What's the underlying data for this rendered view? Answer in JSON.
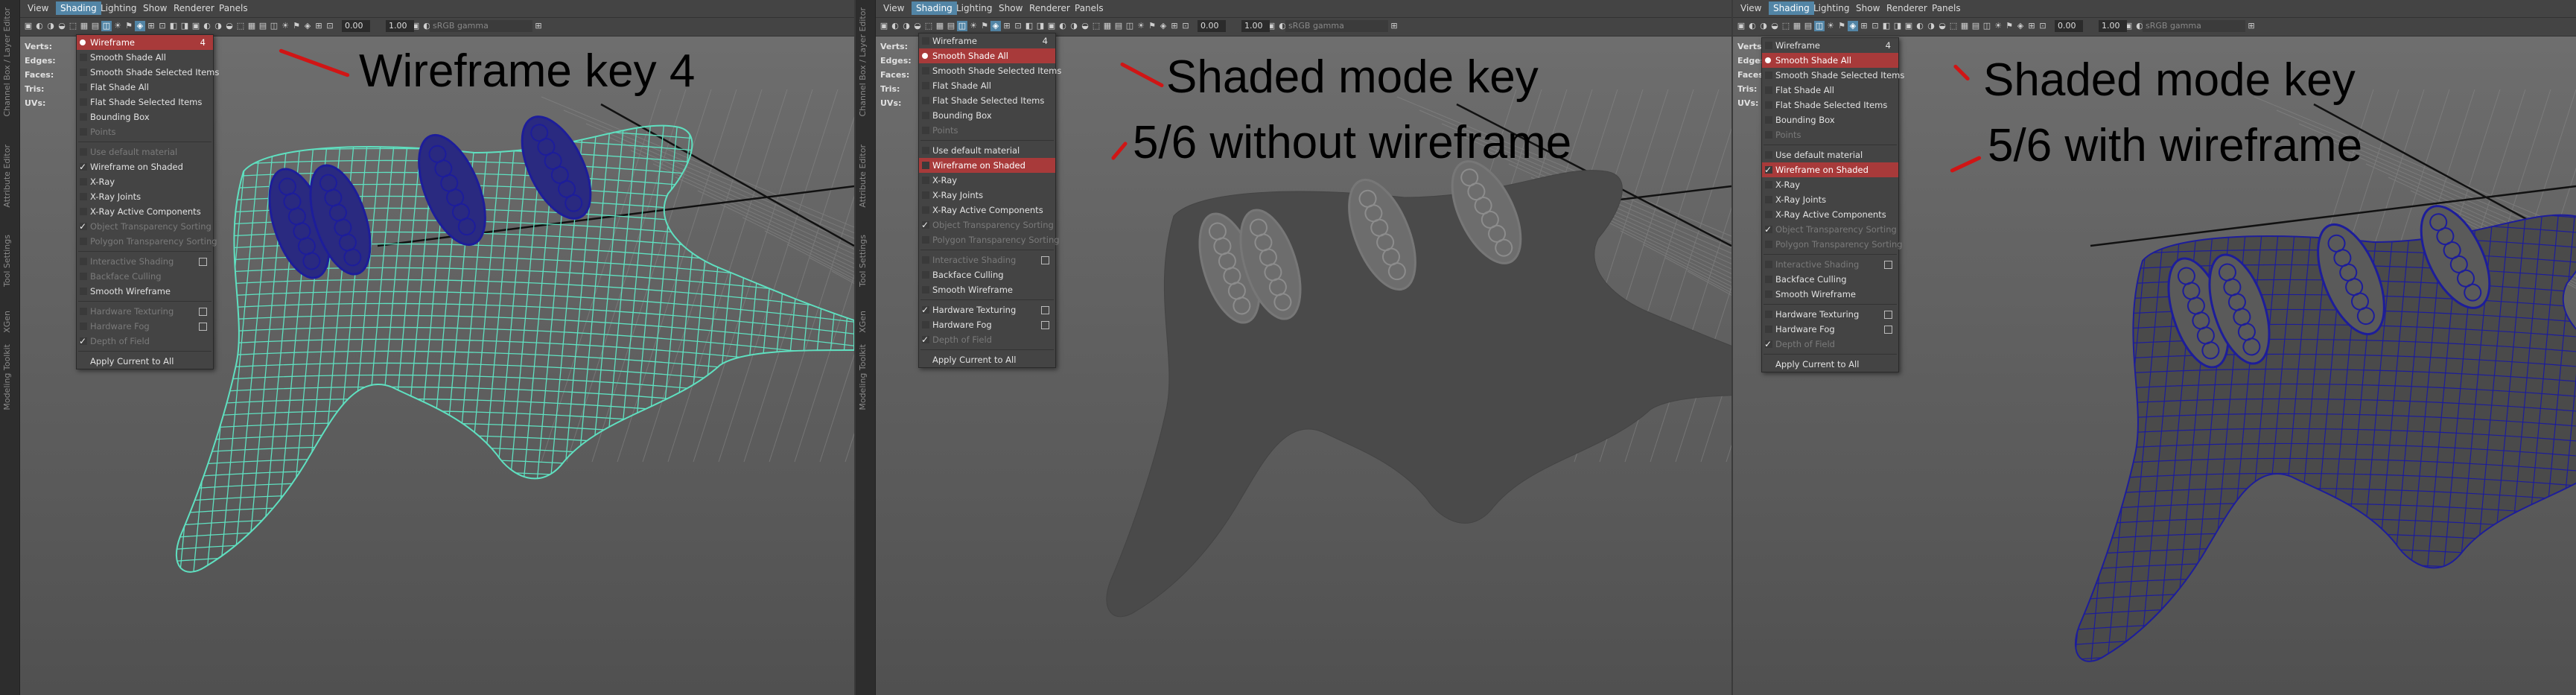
{
  "menubar": [
    "View",
    "Shading",
    "Lighting",
    "Show",
    "Renderer",
    "Panels"
  ],
  "side_tabs": [
    "Channel Box / Layer Editor",
    "Attribute Editor",
    "Tool Settings",
    "XGen",
    "Modeling Toolkit"
  ],
  "toolbar": {
    "value_a": "0.00",
    "value_b": "1.00",
    "colorspace": "sRGB gamma"
  },
  "hud_labels": [
    "Verts:",
    "Edges:",
    "Faces:",
    "Tris:",
    "UVs:"
  ],
  "colors": {
    "wire_cyan": "#5fe0c0",
    "wire_blue": "#1d1d9a",
    "menu_highlight": "#a83a3a",
    "annotation_red": "#d01515"
  },
  "panels": [
    {
      "annotation_lines": [
        "Wireframe key 4"
      ],
      "menu": [
        {
          "label": "Wireframe",
          "key": "4",
          "state": "radio-hl"
        },
        {
          "label": "Smooth Shade All",
          "key": "",
          "state": ""
        },
        {
          "label": "Smooth Shade Selected Items",
          "key": "",
          "state": ""
        },
        {
          "label": "Flat Shade All",
          "key": "",
          "state": ""
        },
        {
          "label": "Flat Shade Selected Items",
          "key": "",
          "state": ""
        },
        {
          "label": "Bounding Box",
          "key": "",
          "state": ""
        },
        {
          "label": "Points",
          "key": "",
          "state": "dis"
        },
        {
          "sep": true
        },
        {
          "label": "Use default material",
          "key": "",
          "state": "dis"
        },
        {
          "label": "Wireframe on Shaded",
          "key": "",
          "state": "check"
        },
        {
          "label": "X-Ray",
          "key": "",
          "state": ""
        },
        {
          "label": "X-Ray Joints",
          "key": "",
          "state": ""
        },
        {
          "label": "X-Ray Active Components",
          "key": "",
          "state": ""
        },
        {
          "label": "Object Transparency Sorting",
          "key": "",
          "state": "check-dis"
        },
        {
          "label": "Polygon Transparency Sorting",
          "key": "",
          "state": "dis"
        },
        {
          "sep": true
        },
        {
          "label": "Interactive Shading",
          "key": "",
          "state": "dis-opt"
        },
        {
          "label": "Backface Culling",
          "key": "",
          "state": "dis"
        },
        {
          "label": "Smooth Wireframe",
          "key": "",
          "state": ""
        },
        {
          "sep": true
        },
        {
          "label": "Hardware Texturing",
          "key": "",
          "state": "dis-opt"
        },
        {
          "label": "Hardware Fog",
          "key": "",
          "state": "dis-opt"
        },
        {
          "label": "Depth of Field",
          "key": "",
          "state": "check-dis"
        },
        {
          "sep": true
        },
        {
          "label": "Apply Current to All",
          "key": "",
          "state": "plain"
        }
      ]
    },
    {
      "annotation_lines": [
        "Shaded mode key",
        "5/6 without wireframe"
      ],
      "menu": [
        {
          "label": "Wireframe",
          "key": "4",
          "state": ""
        },
        {
          "label": "Smooth Shade All",
          "key": "",
          "state": "radio-hl"
        },
        {
          "label": "Smooth Shade Selected Items",
          "key": "",
          "state": ""
        },
        {
          "label": "Flat Shade All",
          "key": "",
          "state": ""
        },
        {
          "label": "Flat Shade Selected Items",
          "key": "",
          "state": ""
        },
        {
          "label": "Bounding Box",
          "key": "",
          "state": ""
        },
        {
          "label": "Points",
          "key": "",
          "state": "dis"
        },
        {
          "sep": true
        },
        {
          "label": "Use default material",
          "key": "",
          "state": ""
        },
        {
          "label": "Wireframe on Shaded",
          "key": "",
          "state": "hl"
        },
        {
          "label": "X-Ray",
          "key": "",
          "state": ""
        },
        {
          "label": "X-Ray Joints",
          "key": "",
          "state": ""
        },
        {
          "label": "X-Ray Active Components",
          "key": "",
          "state": ""
        },
        {
          "label": "Object Transparency Sorting",
          "key": "",
          "state": "check-dis"
        },
        {
          "label": "Polygon Transparency Sorting",
          "key": "",
          "state": "dis"
        },
        {
          "sep": true
        },
        {
          "label": "Interactive Shading",
          "key": "",
          "state": "dis-opt"
        },
        {
          "label": "Backface Culling",
          "key": "",
          "state": ""
        },
        {
          "label": "Smooth Wireframe",
          "key": "",
          "state": ""
        },
        {
          "sep": true
        },
        {
          "label": "Hardware Texturing",
          "key": "",
          "state": "check-opt"
        },
        {
          "label": "Hardware Fog",
          "key": "",
          "state": "opt"
        },
        {
          "label": "Depth of Field",
          "key": "",
          "state": "check-dis"
        },
        {
          "sep": true
        },
        {
          "label": "Apply Current to All",
          "key": "",
          "state": "plain"
        }
      ]
    },
    {
      "annotation_lines": [
        "Shaded mode key",
        "5/6 with wireframe"
      ],
      "menu": [
        {
          "label": "Wireframe",
          "key": "4",
          "state": ""
        },
        {
          "label": "Smooth Shade All",
          "key": "",
          "state": "radio-hl"
        },
        {
          "label": "Smooth Shade Selected Items",
          "key": "",
          "state": ""
        },
        {
          "label": "Flat Shade All",
          "key": "",
          "state": ""
        },
        {
          "label": "Flat Shade Selected Items",
          "key": "",
          "state": ""
        },
        {
          "label": "Bounding Box",
          "key": "",
          "state": ""
        },
        {
          "label": "Points",
          "key": "",
          "state": "dis"
        },
        {
          "sep": true
        },
        {
          "label": "Use default material",
          "key": "",
          "state": ""
        },
        {
          "label": "Wireframe on Shaded",
          "key": "",
          "state": "check-hl"
        },
        {
          "label": "X-Ray",
          "key": "",
          "state": ""
        },
        {
          "label": "X-Ray Joints",
          "key": "",
          "state": ""
        },
        {
          "label": "X-Ray Active Components",
          "key": "",
          "state": ""
        },
        {
          "label": "Object Transparency Sorting",
          "key": "",
          "state": "check-dis"
        },
        {
          "label": "Polygon Transparency Sorting",
          "key": "",
          "state": "dis"
        },
        {
          "sep": true
        },
        {
          "label": "Interactive Shading",
          "key": "",
          "state": "dis-opt"
        },
        {
          "label": "Backface Culling",
          "key": "",
          "state": ""
        },
        {
          "label": "Smooth Wireframe",
          "key": "",
          "state": ""
        },
        {
          "sep": true
        },
        {
          "label": "Hardware Texturing",
          "key": "",
          "state": "opt"
        },
        {
          "label": "Hardware Fog",
          "key": "",
          "state": "opt"
        },
        {
          "label": "Depth of Field",
          "key": "",
          "state": "check-dis"
        },
        {
          "sep": true
        },
        {
          "label": "Apply Current to All",
          "key": "",
          "state": "plain"
        }
      ]
    }
  ]
}
